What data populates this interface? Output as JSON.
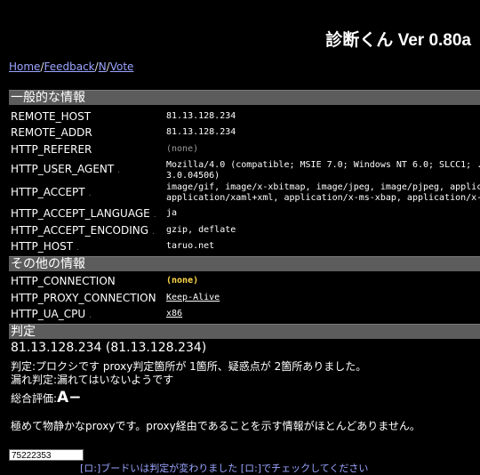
{
  "title": "診断くん Ver 0.80a",
  "nav": {
    "home": "Home",
    "feedback": "Feedback",
    "n": "N",
    "vote": "Vote"
  },
  "sections": {
    "general": "一般的な情報",
    "other": "その他の情報",
    "verdict": "判定"
  },
  "general_rows": [
    {
      "key": "REMOTE_HOST",
      "value": "81.13.128.234"
    },
    {
      "key": "REMOTE_ADDR",
      "value": "81.13.128.234"
    },
    {
      "key": "HTTP_REFERER",
      "value": "(none)"
    },
    {
      "key": "HTTP_USER_AGENT",
      "value": "Mozilla/4.0 (compatible; MSIE 7.0; Windows NT 6.0; SLCC1; .N",
      "value2": "3.0.04506)"
    },
    {
      "key": "HTTP_ACCEPT",
      "value": "image/gif, image/x-xbitmap, image/jpeg, image/pjpeg, applica",
      "value2": "application/xaml+xml, application/x-ms-xbap, application/x-s"
    },
    {
      "key": "HTTP_ACCEPT_LANGUAGE",
      "value": "ja"
    },
    {
      "key": "HTTP_ACCEPT_ENCODING",
      "value": "gzip, deflate"
    },
    {
      "key": "HTTP_HOST",
      "value": "taruo.net"
    }
  ],
  "other_rows": [
    {
      "key": "HTTP_CONNECTION",
      "value": "(none)"
    },
    {
      "key": "HTTP_PROXY_CONNECTION",
      "value": "Keep-Alive"
    },
    {
      "key": "HTTP_UA_CPU",
      "value": "x86"
    }
  ],
  "verdict": {
    "ip": "81.13.128.234 (81.13.128.234)",
    "line1": "判定:プロクシです proxy判定箇所が 1箇所、疑惑点が 2箇所ありました。",
    "line2": "漏れ判定:漏れてはいないようです",
    "score_label": "総合評価:",
    "score": "A−",
    "comment": "極めて物静かなproxyです。proxy経由であることを示す情報がほとんどありません。"
  },
  "counter": "75222353",
  "footer": "[ロ:]ブードいは判定が変わりました [ロ:]でチェックしてください"
}
